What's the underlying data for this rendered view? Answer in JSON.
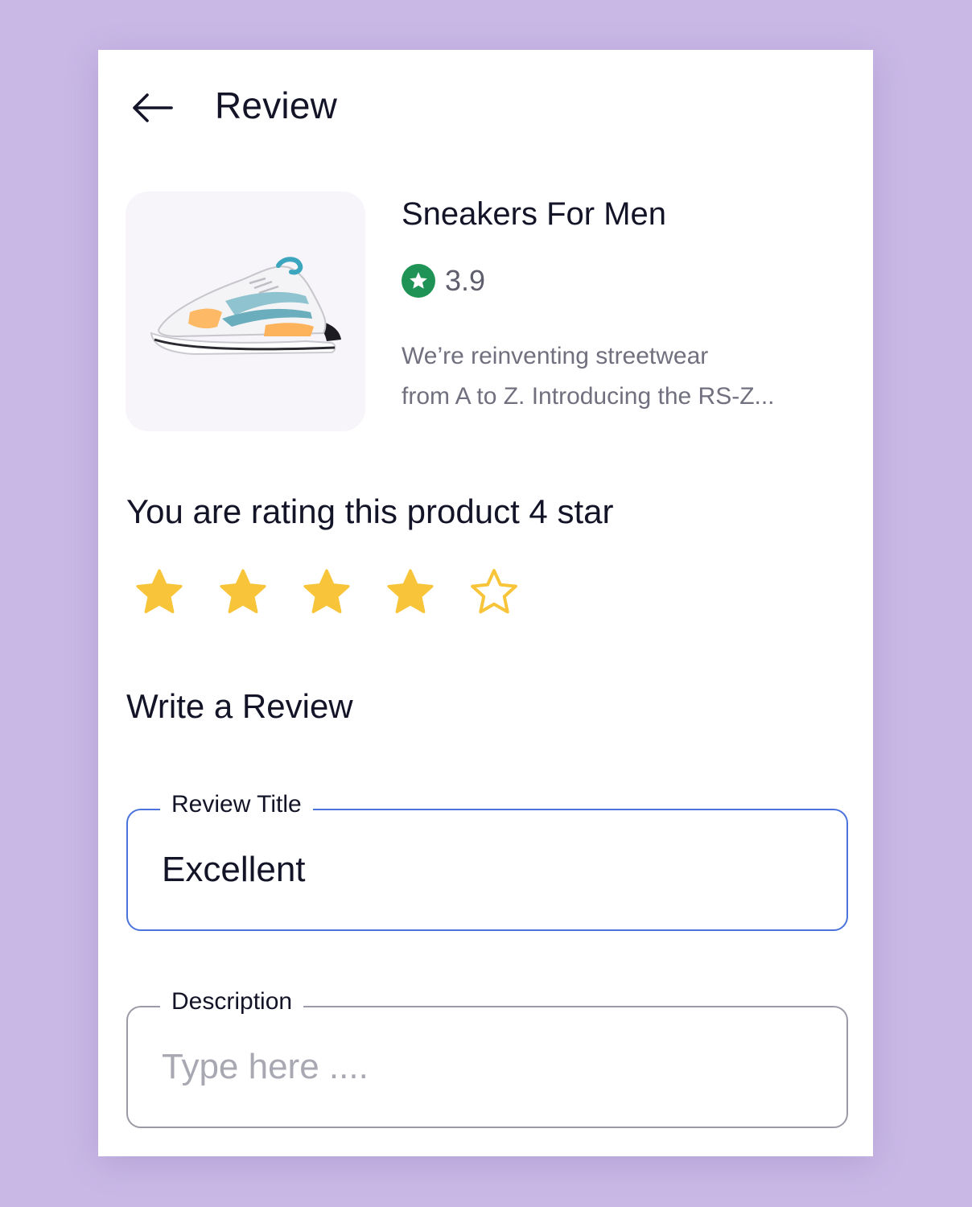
{
  "header": {
    "title": "Review",
    "back_icon": "arrow-left-icon"
  },
  "product": {
    "name": "Sneakers For Men",
    "rating": "3.9",
    "rating_icon": "star-icon",
    "rating_color": "#1f9255",
    "description_lines": [
      "We’re reinventing streetwear",
      "from A to Z. Introducing the RS-Z..."
    ],
    "image_icon": "sneaker-image"
  },
  "rating_input": {
    "prompt": "You are rating this product 4 star",
    "value": 4,
    "max": 5,
    "star_color": "#f8c53a"
  },
  "review_form": {
    "section_title": "Write a Review",
    "title_field": {
      "label": "Review Title",
      "value": "Excellent",
      "focused": true
    },
    "description_field": {
      "label": "Description",
      "value": "",
      "placeholder": "Type here ...."
    }
  },
  "colors": {
    "background": "#c9b8e6",
    "focus_border": "#4b73dc"
  }
}
